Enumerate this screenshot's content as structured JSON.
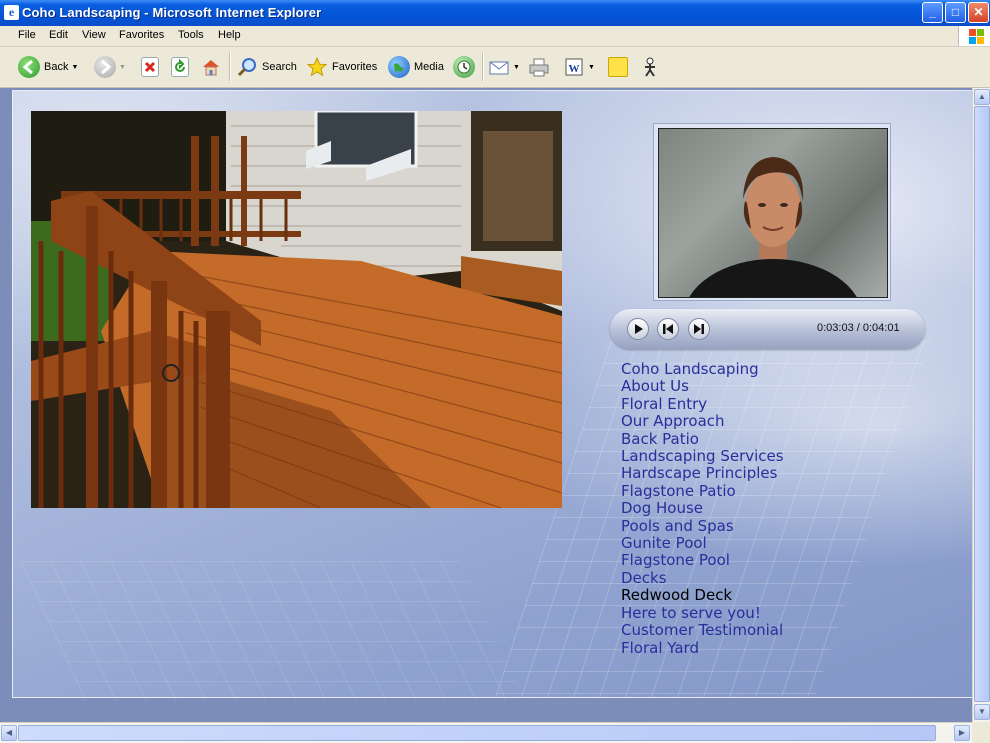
{
  "window": {
    "title": "Coho Landscaping - Microsoft Internet Explorer",
    "app_icon": "ie-icon",
    "controls": [
      "minimize",
      "maximize",
      "close"
    ]
  },
  "menu": [
    "File",
    "Edit",
    "View",
    "Favorites",
    "Tools",
    "Help"
  ],
  "toolbar": {
    "back_label": "Back",
    "search_label": "Search",
    "favorites_label": "Favorites",
    "media_label": "Media"
  },
  "player": {
    "time": "0:03:03 / 0:04:01",
    "buttons": [
      "play",
      "previous",
      "next"
    ]
  },
  "nav": {
    "items": [
      "Coho Landscaping",
      "About Us",
      "Floral Entry",
      "Our Approach",
      "Back Patio",
      "Landscaping Services",
      "Hardscape Principles",
      "Flagstone Patio",
      "Dog House",
      "Pools and Spas",
      "Gunite Pool",
      "Flagstone Pool",
      "Decks",
      "Redwood Deck",
      "Here to serve you!",
      "Customer Testimonial",
      "Floral Yard"
    ],
    "current": "Redwood Deck"
  },
  "colors": {
    "link": "#2a2e9a",
    "current_link": "#000000",
    "titlebar": "#0454d8",
    "page_background": "#a9b8dc"
  }
}
